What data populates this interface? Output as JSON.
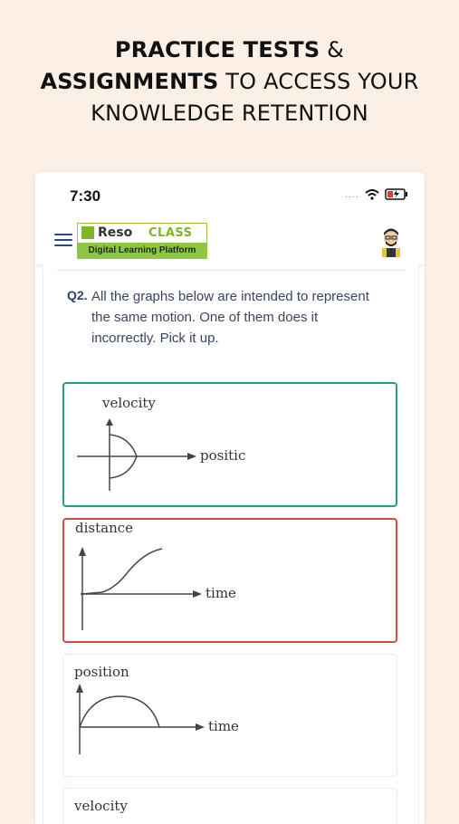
{
  "headline": {
    "line1_bold": "PRACTICE TESTS",
    "line1_rest": " &",
    "line2_bold": "ASSIGNMENTS",
    "line2_rest": " TO ACCESS YOUR",
    "line3": "KNOWLEDGE RETENTION"
  },
  "status_bar": {
    "time": "7:30",
    "signal_dots": "....",
    "icons": [
      "wifi-icon",
      "battery-charging-icon"
    ]
  },
  "app_bar": {
    "menu_icon": "hamburger-menu-icon",
    "logo_word": "Reso",
    "logo_class": "CLASS",
    "logo_subtitle": "Digital Learning Platform",
    "avatar_icon": "user-avatar-icon"
  },
  "question": {
    "number": "Q2.",
    "text": "All the graphs below are intended to represent the same motion. One of them does it incorrectly. Pick it up."
  },
  "options": [
    {
      "y_label": "velocity",
      "x_label": "positic",
      "state": "correct",
      "border_color": "#2aa06a"
    },
    {
      "y_label": "distance",
      "x_label": "time",
      "state": "incorrect",
      "border_color": "#d84a4a"
    },
    {
      "y_label": "position",
      "x_label": "time",
      "state": "neutral",
      "border_color": "#ebebeb"
    },
    {
      "y_label": "velocity",
      "x_label": "",
      "state": "neutral",
      "border_color": "#ebebeb"
    }
  ]
}
